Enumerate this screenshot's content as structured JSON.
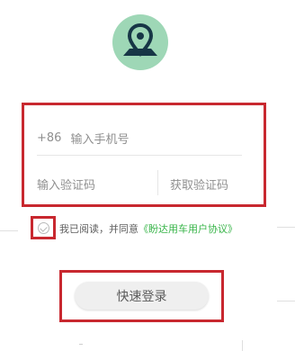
{
  "logo": {
    "icon": "map-pin-icon",
    "bg_color": "#9ed7b6",
    "fg_color": "#173646"
  },
  "form": {
    "phone_prefix": "+86",
    "phone_placeholder": "输入手机号",
    "code_placeholder": "输入验证码",
    "get_code_label": "获取验证码"
  },
  "agreement": {
    "prefix": "我已阅读，并同意",
    "link": "《盼达用车用户协议》"
  },
  "login_button": {
    "label": "快速登录"
  },
  "colors": {
    "highlight": "#c8282f",
    "link": "#39b54a",
    "button_bg": "#efefef"
  }
}
